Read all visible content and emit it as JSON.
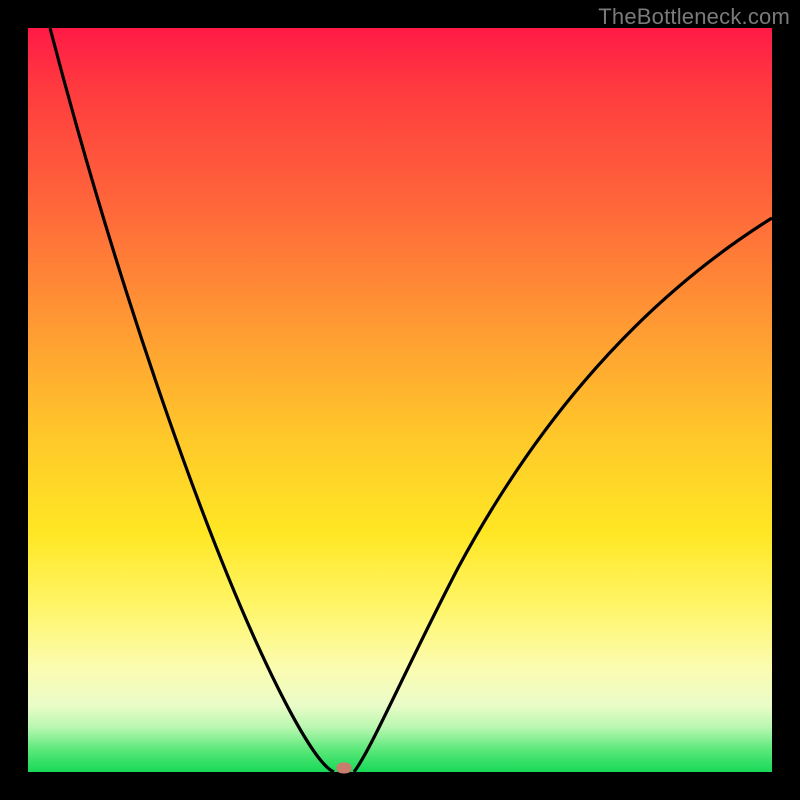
{
  "watermark": "TheBottleneck.com",
  "colors": {
    "frame": "#000000",
    "curve": "#000000",
    "marker": "#c97d6e",
    "gradient_stops": [
      {
        "pos": 0,
        "hex": "#ff1a46"
      },
      {
        "pos": 8,
        "hex": "#ff3a3f"
      },
      {
        "pos": 25,
        "hex": "#ff6a3a"
      },
      {
        "pos": 40,
        "hex": "#ff9a33"
      },
      {
        "pos": 55,
        "hex": "#ffc82a"
      },
      {
        "pos": 68,
        "hex": "#ffe724"
      },
      {
        "pos": 78,
        "hex": "#fff66a"
      },
      {
        "pos": 86,
        "hex": "#fbfcb0"
      },
      {
        "pos": 91,
        "hex": "#eafcc8"
      },
      {
        "pos": 94,
        "hex": "#b9f7b0"
      },
      {
        "pos": 97,
        "hex": "#5be87a"
      },
      {
        "pos": 100,
        "hex": "#17d957"
      }
    ]
  },
  "chart_data": {
    "type": "line",
    "title": "",
    "xlabel": "",
    "ylabel": "",
    "marker": {
      "x": 0.425,
      "y": 0.0
    },
    "left_branch": {
      "x_start": 0.03,
      "y_start": 1.0,
      "x_end": 0.41,
      "y_end": 0.0,
      "description": "steep decreasing convex curve from top-left down to minimum near x≈0.42"
    },
    "right_branch": {
      "x_start": 0.44,
      "y_start": 0.0,
      "x_end": 1.0,
      "y_end": 0.745,
      "description": "increasing concave curve from minimum near x≈0.42 up toward right edge at ~74% height"
    },
    "xlim": [
      0,
      1
    ],
    "ylim": [
      0,
      1
    ],
    "note": "Axes are unlabeled; values are normalized fractions of plot area width/height as read from pixels."
  }
}
